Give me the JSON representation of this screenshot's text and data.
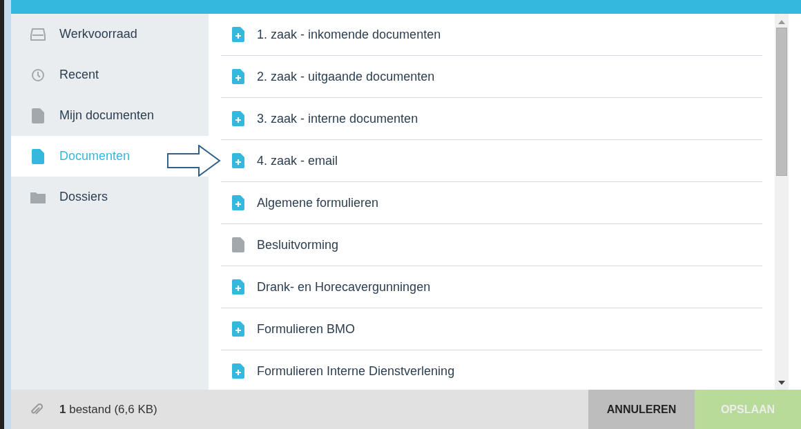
{
  "sidebar": {
    "items": [
      {
        "label": "Werkvoorraad",
        "kind": "inbox",
        "selected": false
      },
      {
        "label": "Recent",
        "kind": "clock",
        "selected": false
      },
      {
        "label": "Mijn documenten",
        "kind": "file",
        "selected": false
      },
      {
        "label": "Documenten",
        "kind": "file",
        "selected": true
      },
      {
        "label": "Dossiers",
        "kind": "folder",
        "selected": false
      }
    ]
  },
  "documents": [
    {
      "label": "1. zaak - inkomende documenten",
      "kind": "add"
    },
    {
      "label": "2. zaak - uitgaande documenten",
      "kind": "add"
    },
    {
      "label": "3. zaak - interne documenten",
      "kind": "add"
    },
    {
      "label": "4. zaak - email",
      "kind": "add"
    },
    {
      "label": "Algemene formulieren",
      "kind": "add"
    },
    {
      "label": "Besluitvorming",
      "kind": "plain"
    },
    {
      "label": "Drank- en Horecavergunningen",
      "kind": "add"
    },
    {
      "label": "Formulieren BMO",
      "kind": "add"
    },
    {
      "label": "Formulieren Interne Dienstverlening",
      "kind": "add"
    }
  ],
  "footer": {
    "attachment": "**1** bestand (6,6 KB)",
    "buttons": [
      {
        "label": "ANNULEREN",
        "kind": "cancel",
        "disabled": false
      },
      {
        "label": "OPSLAAN",
        "kind": "save",
        "disabled": true
      }
    ]
  }
}
